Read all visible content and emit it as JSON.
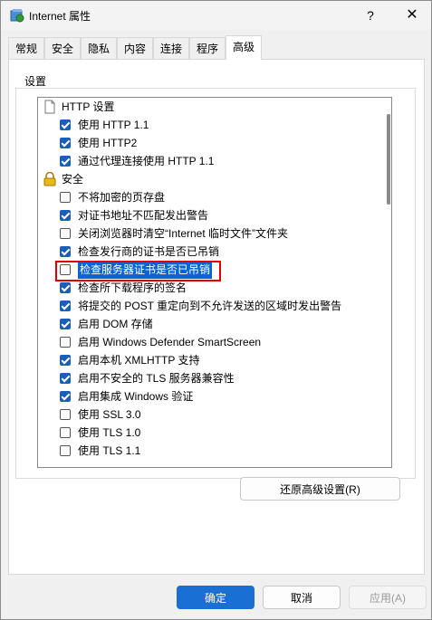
{
  "window": {
    "title": "Internet 属性",
    "help": "?",
    "close": "✕"
  },
  "tabs": [
    "常规",
    "安全",
    "隐私",
    "内容",
    "连接",
    "程序",
    "高级"
  ],
  "active_tab": "高级",
  "settings_group_label": "设置",
  "settings": [
    {
      "type": "category",
      "icon": "document-icon",
      "label": "HTTP 设置"
    },
    {
      "type": "check",
      "checked": true,
      "label": "使用 HTTP 1.1"
    },
    {
      "type": "check",
      "checked": true,
      "label": "使用 HTTP2"
    },
    {
      "type": "check",
      "checked": true,
      "label": "通过代理连接使用 HTTP 1.1"
    },
    {
      "type": "category",
      "icon": "lock-icon",
      "label": "安全"
    },
    {
      "type": "check",
      "checked": false,
      "label": "不将加密的页存盘"
    },
    {
      "type": "check",
      "checked": true,
      "label": "对证书地址不匹配发出警告"
    },
    {
      "type": "check",
      "checked": false,
      "label": "关闭浏览器时清空“Internet 临时文件”文件夹"
    },
    {
      "type": "check",
      "checked": true,
      "label": "检查发行商的证书是否已吊销"
    },
    {
      "type": "check",
      "checked": false,
      "label": "检查服务器证书是否已吊销",
      "selected": true
    },
    {
      "type": "check",
      "checked": true,
      "label": "检查所下载程序的签名"
    },
    {
      "type": "check",
      "checked": true,
      "label": "将提交的 POST 重定向到不允许发送的区域时发出警告"
    },
    {
      "type": "check",
      "checked": true,
      "label": "启用 DOM 存储"
    },
    {
      "type": "check",
      "checked": false,
      "label": "启用 Windows Defender SmartScreen"
    },
    {
      "type": "check",
      "checked": true,
      "label": "启用本机 XMLHTTP 支持"
    },
    {
      "type": "check",
      "checked": true,
      "label": "启用不安全的 TLS 服务器兼容性"
    },
    {
      "type": "check",
      "checked": true,
      "label": "启用集成 Windows 验证"
    },
    {
      "type": "check",
      "checked": false,
      "label": "使用 SSL 3.0"
    },
    {
      "type": "check",
      "checked": false,
      "label": "使用 TLS 1.0"
    },
    {
      "type": "check",
      "checked": false,
      "label": "使用 TLS 1.1"
    }
  ],
  "restore_button": "还原高级设置(R)",
  "buttons": {
    "ok": "确定",
    "cancel": "取消",
    "apply": "应用(A)"
  },
  "colors": {
    "accent": "#1a6fd4",
    "checkbox_on": "#1a5fb4",
    "selection": "#0a64d6",
    "highlight_box": "#e00000"
  }
}
